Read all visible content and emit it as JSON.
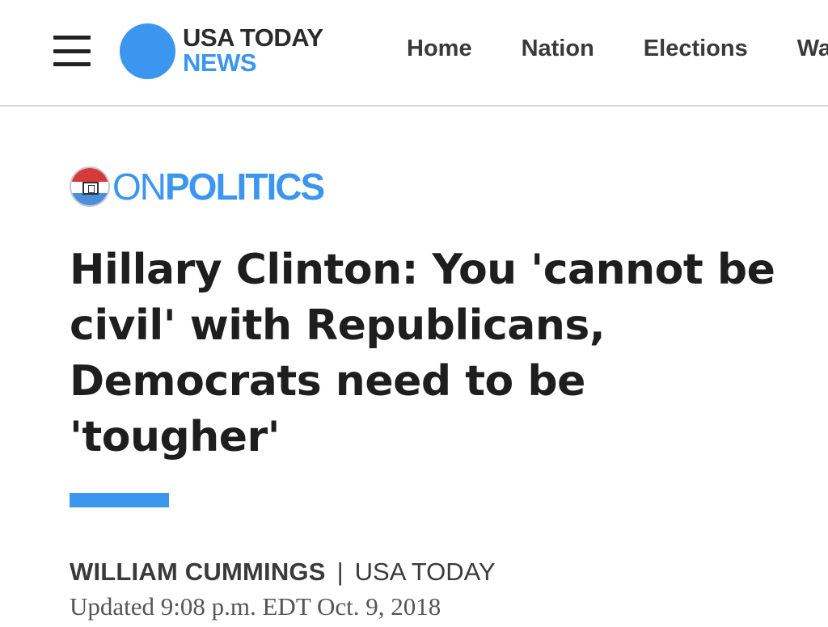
{
  "header": {
    "brand_top": "USA TODAY",
    "brand_bottom": "NEWS",
    "nav": [
      "Home",
      "Nation",
      "Elections",
      "Wa"
    ]
  },
  "section": {
    "label_on": "ON",
    "label_politics": "POLITICS"
  },
  "article": {
    "headline": "Hillary Clinton: You 'cannot be civil' with Republicans, Democrats need to be 'tougher'",
    "author": "WILLIAM CUMMINGS",
    "separator": "|",
    "outlet": "USA TODAY",
    "updated": "Updated 9:08 p.m. EDT Oct. 9, 2018"
  },
  "colors": {
    "accent": "#3c96ef",
    "badge_red": "#d43a3a",
    "badge_blue": "#4a8fdc"
  },
  "icons": {
    "menu": "hamburger-menu-icon",
    "section_badge": "ballot-box-badge-icon"
  }
}
